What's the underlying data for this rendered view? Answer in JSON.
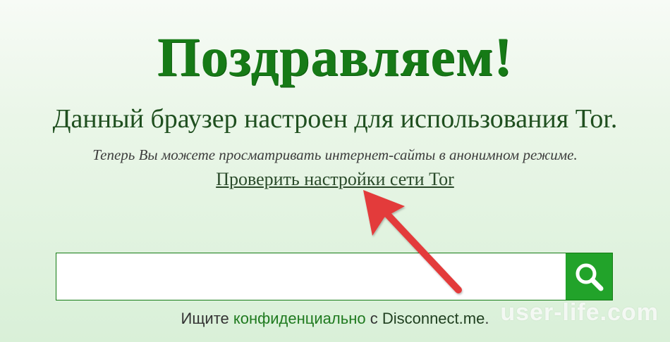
{
  "page": {
    "headline": "Поздравляем!",
    "subtitle": "Данный браузер настроен для использования Tor.",
    "note": "Теперь Вы можете просматривать интернет-сайты в анонимном режиме.",
    "check_link": "Проверить настройки сети Tor"
  },
  "search": {
    "input_value": "",
    "button_icon": "search-icon"
  },
  "footer": {
    "prefix": "Ищите ",
    "accent": "конфиденциально",
    "middle": " с ",
    "link": "Disconnect.me",
    "suffix": "."
  },
  "watermark": "user-life.com",
  "colors": {
    "headline": "#167a16",
    "accent": "#22a32a",
    "arrow": "#e33b3b"
  }
}
